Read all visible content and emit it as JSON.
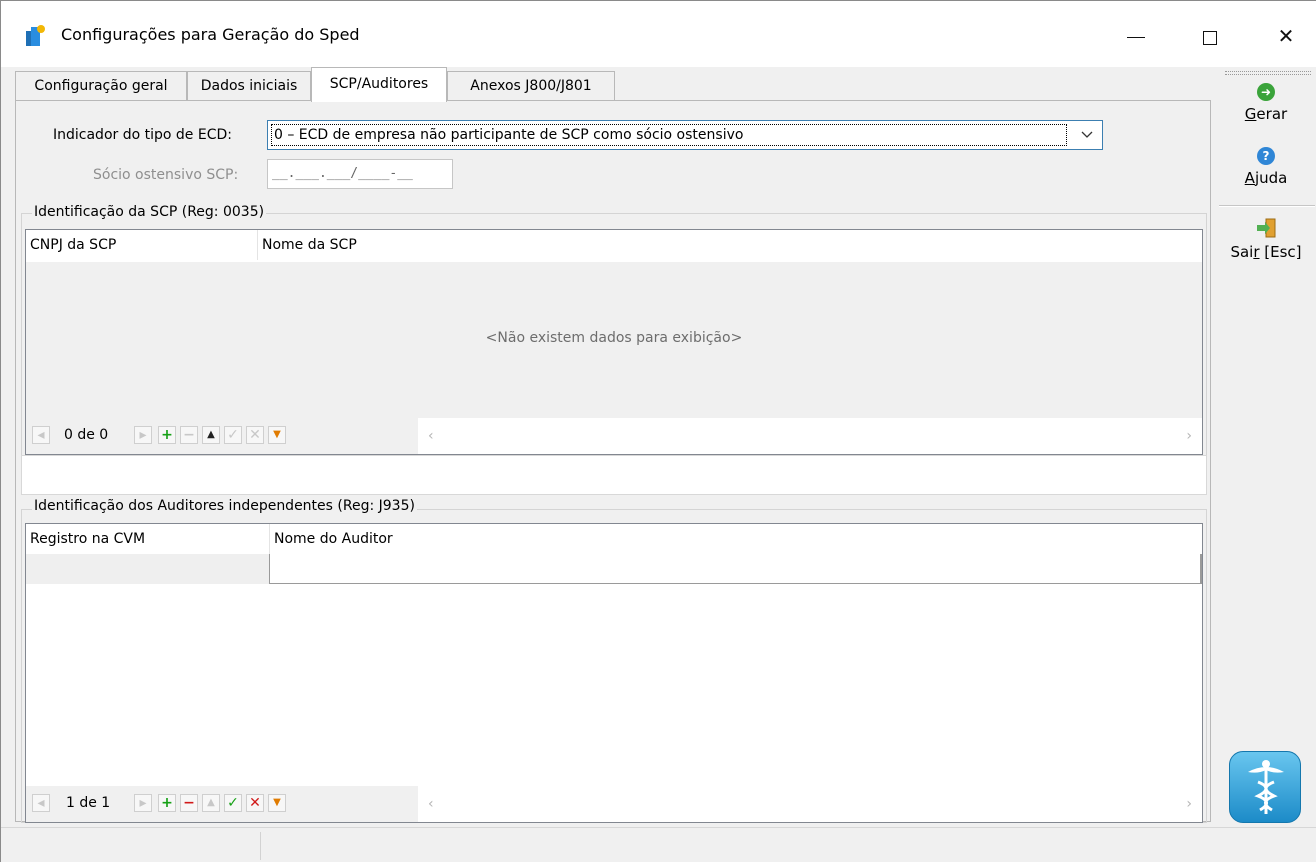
{
  "window": {
    "title": "Configurações para Geração do Sped",
    "min_glyph": "—",
    "close_glyph": "✕"
  },
  "tabs": [
    {
      "label": "Configuração geral",
      "active": false
    },
    {
      "label": "Dados iniciais",
      "active": false
    },
    {
      "label": "SCP/Auditores",
      "active": true
    },
    {
      "label": "Anexos J800/J801",
      "active": false
    }
  ],
  "form": {
    "ecd_label": "Indicador do tipo de ECD:",
    "ecd_value": "0 – ECD de empresa não participante de SCP como sócio ostensivo",
    "socio_label": "Sócio ostensivo SCP:",
    "socio_mask": "__.___.___/____-__"
  },
  "scp_group": {
    "title": "Identificação da SCP (Reg: 0035)",
    "columns": [
      "CNPJ da SCP",
      "Nome da SCP"
    ],
    "rows": [],
    "empty_message": "<Não existem dados para exibição>",
    "nav_count": "0 de 0"
  },
  "auditores_group": {
    "title": "Identificação dos  Auditores independentes (Reg: J935)",
    "columns": [
      "Registro na CVM",
      "Nome do Auditor"
    ],
    "rows": [
      {
        "registro": "",
        "nome": ""
      }
    ],
    "nav_count": "1 de 1"
  },
  "sidebar": {
    "gerar_label": "Gerar",
    "ajuda_label": "Ajuda",
    "sair_label": "Sair [Esc]"
  },
  "colors": {
    "green": "#16a116",
    "red": "#d11919",
    "orange": "#e07b00",
    "accent_blue": "#3c7fb1"
  }
}
